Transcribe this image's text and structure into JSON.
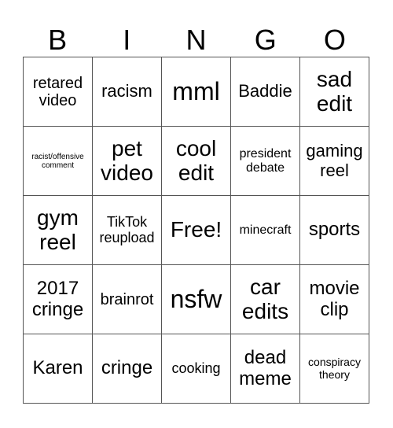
{
  "title_letters": [
    "B",
    "I",
    "N",
    "G",
    "O"
  ],
  "rows": [
    [
      {
        "text": "retared video",
        "size": 20
      },
      {
        "text": "racism",
        "size": 22
      },
      {
        "text": "mml",
        "size": 32
      },
      {
        "text": "Baddie",
        "size": 22
      },
      {
        "text": "sad edit",
        "size": 28
      }
    ],
    [
      {
        "text": "racist/offensive comment",
        "size": 10
      },
      {
        "text": "pet video",
        "size": 28
      },
      {
        "text": "cool edit",
        "size": 28
      },
      {
        "text": "president debate",
        "size": 16
      },
      {
        "text": "gaming reel",
        "size": 22
      }
    ],
    [
      {
        "text": "gym reel",
        "size": 28
      },
      {
        "text": "TikTok reupload",
        "size": 18
      },
      {
        "text": "Free!",
        "size": 28
      },
      {
        "text": "minecraft",
        "size": 16
      },
      {
        "text": "sports",
        "size": 24
      }
    ],
    [
      {
        "text": "2017 cringe",
        "size": 24
      },
      {
        "text": "brainrot",
        "size": 20
      },
      {
        "text": "nsfw",
        "size": 32
      },
      {
        "text": "car edits",
        "size": 28
      },
      {
        "text": "movie clip",
        "size": 24
      }
    ],
    [
      {
        "text": "Karen",
        "size": 24
      },
      {
        "text": "cringe",
        "size": 24
      },
      {
        "text": "cooking",
        "size": 18
      },
      {
        "text": "dead meme",
        "size": 24
      },
      {
        "text": "conspiracy theory",
        "size": 14
      }
    ]
  ]
}
